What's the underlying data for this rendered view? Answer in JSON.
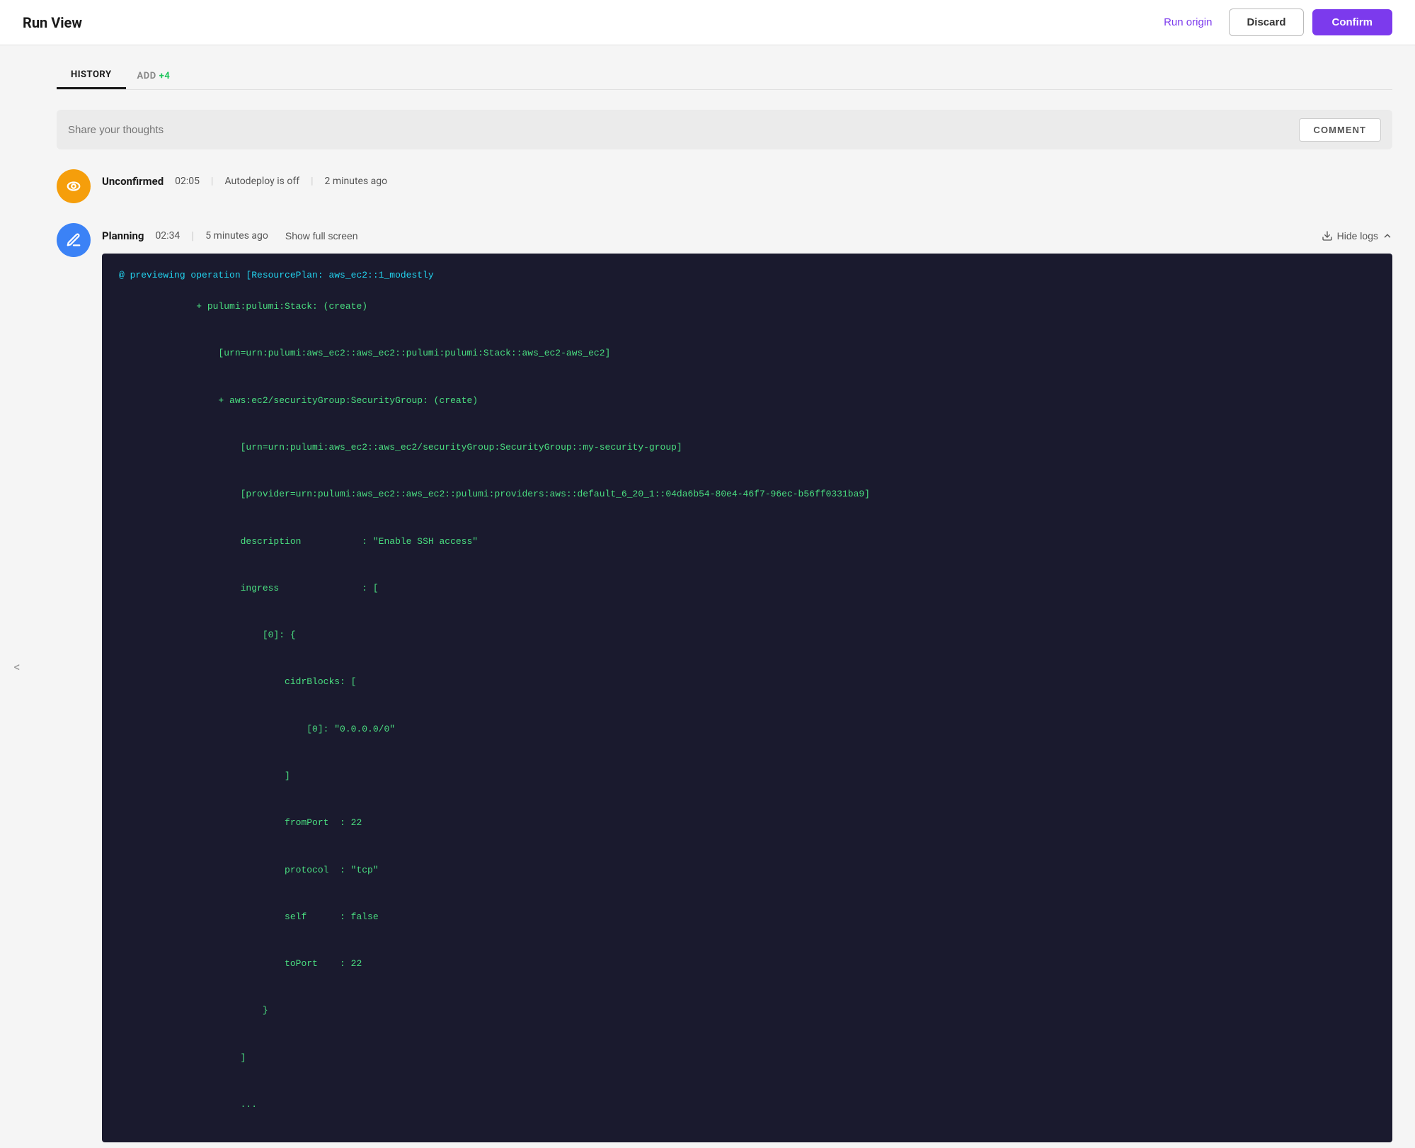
{
  "header": {
    "title": "Run View",
    "run_origin_label": "Run origin",
    "discard_label": "Discard",
    "confirm_label": "Confirm"
  },
  "tabs": {
    "history_label": "HISTORY",
    "add_label": "ADD",
    "add_badge": "+4"
  },
  "comment": {
    "placeholder": "Share your thoughts",
    "button_label": "COMMENT"
  },
  "timeline": [
    {
      "id": "unconfirmed",
      "label": "Unconfirmed",
      "time": "02:05",
      "separator1": "|",
      "autodeploy": "Autodeploy is off",
      "separator2": "|",
      "ago": "2 minutes ago",
      "avatar_type": "orange"
    }
  ],
  "planning": {
    "label": "Planning",
    "time": "02:34",
    "separator": "|",
    "ago": "5 minutes ago",
    "show_full_screen": "Show full screen",
    "hide_logs": "Hide logs",
    "avatar_type": "blue"
  },
  "code": {
    "line1": "@ previewing operation [ResourcePlan: aws_ec2::1_modestly",
    "line2": "+ pulumi:pulumi:Stack: (create)",
    "line3": "    [urn=urn:pulumi:aws_ec2::aws_ec2::pulumi:pulumi:Stack::aws_ec2-aws_ec2]",
    "line4": "    + aws:ec2/securityGroup:SecurityGroup: (create)",
    "line5": "        [urn=urn:pulumi:aws_ec2::aws_ec2/securityGroup:SecurityGroup::my-security-group]",
    "line6": "        [provider=urn:pulumi:aws_ec2::aws_ec2::pulumi:providers:aws::default_6_20_1::04da6b54-80e4-46f7-96ec-b56ff0331ba9]",
    "line7": "        description           : \"Enable SSH access\"",
    "line8": "        ingress               : [",
    "line9": "            [0]: {",
    "line10": "                cidrBlocks: [",
    "line11": "                    [0]: \"0.0.0.0/0\"",
    "line12": "                ]",
    "line13": "                fromPort  : 22",
    "line14": "                protocol  : \"tcp\"",
    "line15": "                self      : false",
    "line16": "                toPort    : 22",
    "line17": "            }",
    "line18": "        ]",
    "line19": "        ..."
  },
  "sidebar": {
    "arrow_label": "<"
  }
}
